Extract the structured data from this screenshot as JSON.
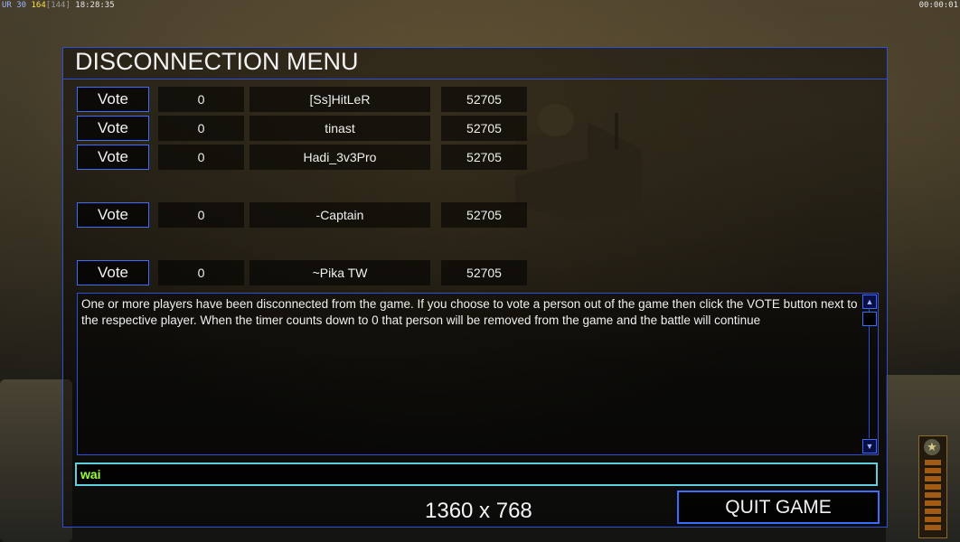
{
  "topbar": {
    "left_prefix": "UR 30",
    "left_value": "164",
    "left_bracket": "[144]",
    "left_time": "18:28:35",
    "right_time": "00:00:01"
  },
  "panel": {
    "title": "DISCONNECTION MENU",
    "vote_label": "Vote",
    "players": [
      {
        "votes": "0",
        "name": "[Ss]HitLeR",
        "timer": "52705"
      },
      {
        "votes": "0",
        "name": "tinast",
        "timer": "52705"
      },
      {
        "votes": "0",
        "name": "Hadi_3v3Pro",
        "timer": "52705"
      },
      {
        "votes": "0",
        "name": "-Captain",
        "timer": "52705"
      },
      {
        "votes": "0",
        "name": "~Pika TW",
        "timer": "52705"
      }
    ],
    "message": "One or more players have been disconnected from the game. If you choose to vote a person out of the game then click the VOTE button next to the respective player. When the timer counts down to 0 that person will be removed from the game and the battle will continue",
    "chat_value": "wai",
    "resolution": "1360 x 768",
    "quit_label": "QUIT GAME"
  },
  "colors": {
    "border_blue": "#2f4fd8",
    "chat_border": "#5fcfe0",
    "chat_text": "#9cff3a",
    "topbar_yellow": "#ffe24a"
  },
  "icons": [
    "scroll-up-icon",
    "scroll-down-icon",
    "rank-star-icon"
  ]
}
